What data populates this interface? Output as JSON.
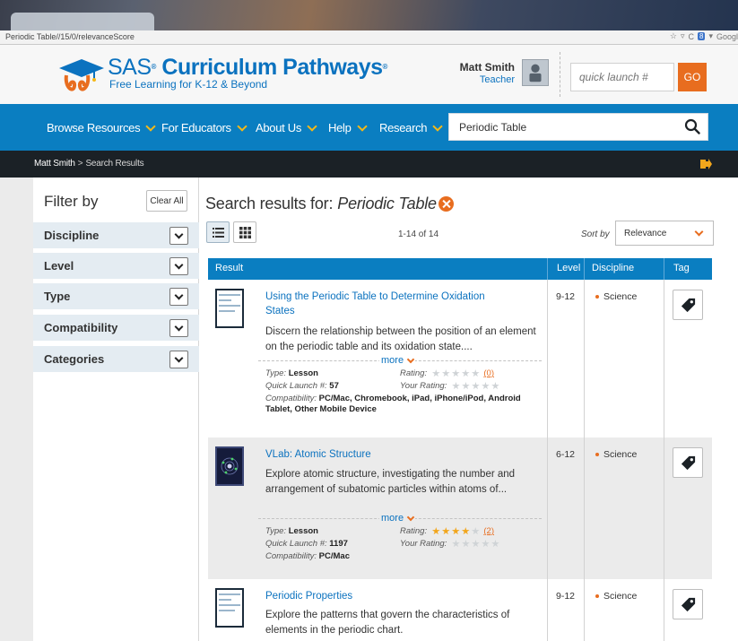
{
  "browser": {
    "url": "Periodic Table//15/0/relevanceScore",
    "search_badge": "8",
    "search_engine": "Googl"
  },
  "header": {
    "brand_prefix": "SAS",
    "brand_name": "Curriculum Pathways",
    "tagline": "Free Learning for K-12 & Beyond",
    "user_name": "Matt Smith",
    "user_role": "Teacher",
    "quick_launch_placeholder": "quick launch #",
    "go_label": "GO"
  },
  "nav": {
    "items": [
      {
        "label": "Browse Resources"
      },
      {
        "label": "For Educators"
      },
      {
        "label": "About Us"
      },
      {
        "label": "Help"
      },
      {
        "label": "Research"
      }
    ],
    "search_value": "Periodic Table"
  },
  "breadcrumb": {
    "home": "Matt Smith",
    "separator": ">",
    "current": "Search Results"
  },
  "sidebar": {
    "title": "Filter by",
    "clear_all": "Clear All",
    "facets": [
      "Discipline",
      "Level",
      "Type",
      "Compatibility",
      "Categories"
    ]
  },
  "results": {
    "heading_prefix": "Search results for:",
    "query": "Periodic Table",
    "count": "1-14 of 14",
    "sort_label": "Sort by",
    "sort_value": "Relevance",
    "columns": {
      "result": "Result",
      "level": "Level",
      "discipline": "Discipline",
      "tag": "Tag"
    },
    "items": [
      {
        "title": "Using the Periodic Table to Determine Oxidation States",
        "description": "Discern the relationship between the position of an element on the periodic table and its oxidation state....",
        "more": "more",
        "type_label": "Type:",
        "type": "Lesson",
        "ql_label": "Quick Launch #:",
        "quick_launch": "57",
        "rating_label": "Rating:",
        "rating": 0,
        "rating_count": "(0)",
        "your_rating_label": "Your Rating:",
        "compat_label": "Compatibility:",
        "compatibility": "PC/Mac, Chromebook, iPad, iPhone/iPod, Android Tablet, Other Mobile Device",
        "level": "9-12",
        "discipline": "Science"
      },
      {
        "title": "VLab: Atomic Structure",
        "description": "Explore atomic structure, investigating the number and arrangement of subatomic particles within atoms of...",
        "more": "more",
        "type_label": "Type:",
        "type": "Lesson",
        "ql_label": "Quick Launch #:",
        "quick_launch": "1197",
        "rating_label": "Rating:",
        "rating": 4,
        "rating_count": "(2)",
        "your_rating_label": "Your Rating:",
        "compat_label": "Compatibility:",
        "compatibility": "PC/Mac",
        "level": "6-12",
        "discipline": "Science"
      },
      {
        "title": "Periodic Properties",
        "description": "Explore the patterns that govern the characteristics of elements in the periodic chart.",
        "level": "9-12",
        "discipline": "Science"
      }
    ]
  },
  "colors": {
    "brand_blue": "#0a7ec1",
    "accent_orange": "#e86d1f",
    "star_gold": "#f2a61c",
    "dark_bar": "#1b2126"
  }
}
